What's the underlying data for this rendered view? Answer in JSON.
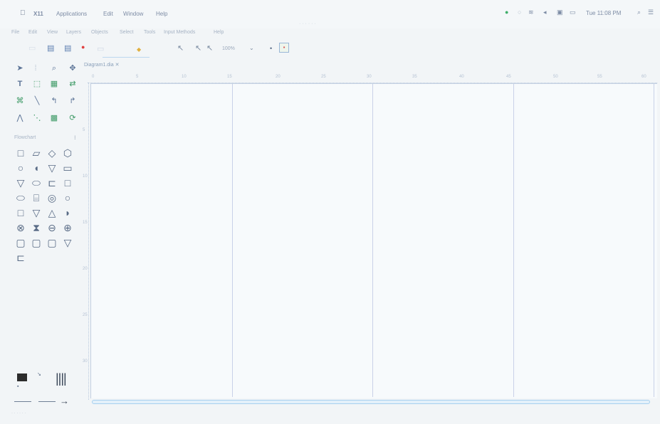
{
  "menubar": {
    "apple": "",
    "app": "X11",
    "items": [
      "Applications",
      "Edit",
      "Window",
      "Help"
    ],
    "clock": "Tue 11:08 PM"
  },
  "app_menu": [
    "File",
    "Edit",
    "View",
    "Layers",
    "Objects",
    "Select",
    "Tools",
    "Input Methods",
    "Help"
  ],
  "toolbar": {
    "zoom": "100%"
  },
  "diagram_tab": {
    "label": "Diagram1.dia",
    "close": "✕"
  },
  "sheet_label": "Flowchart",
  "ruler_top_ticks": [
    "0",
    "5",
    "10",
    "15",
    "20",
    "25",
    "30",
    "35",
    "40",
    "45",
    "50",
    "55",
    "60"
  ],
  "ruler_left_ticks": [
    "5",
    "10",
    "15",
    "20",
    "25",
    "30"
  ],
  "colors": {
    "accent": "#3f8ad8",
    "canvas": "#f7fafc",
    "guide": "#c9d1e8"
  }
}
